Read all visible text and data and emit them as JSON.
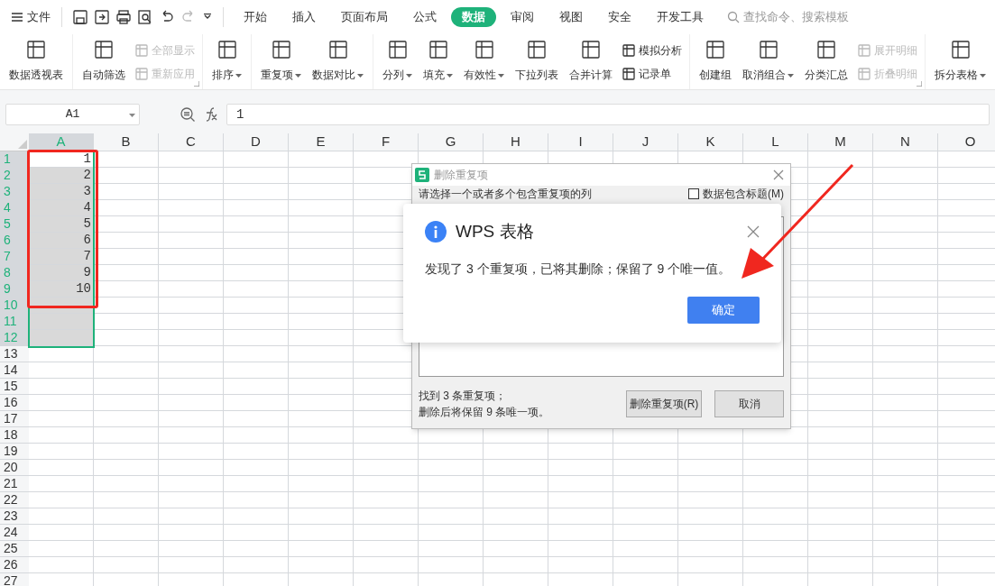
{
  "menu": {
    "label": "文件"
  },
  "tabs": [
    {
      "label": "开始",
      "selected": false
    },
    {
      "label": "插入",
      "selected": false
    },
    {
      "label": "页面布局",
      "selected": false
    },
    {
      "label": "公式",
      "selected": false
    },
    {
      "label": "数据",
      "selected": true
    },
    {
      "label": "审阅",
      "selected": false
    },
    {
      "label": "视图",
      "selected": false
    },
    {
      "label": "安全",
      "selected": false
    },
    {
      "label": "开发工具",
      "selected": false
    }
  ],
  "search": {
    "placeholder": "查找命令、搜索模板"
  },
  "ribbon": {
    "groups": [
      {
        "items": [
          {
            "kind": "big",
            "label": "数据透视表",
            "dropdown": false
          }
        ]
      },
      {
        "launcher": true,
        "items": [
          {
            "kind": "big",
            "label": "自动筛选",
            "dropdown": false
          },
          {
            "kind": "stack",
            "entries": [
              {
                "label": "全部显示",
                "disabled": true
              },
              {
                "label": "重新应用",
                "disabled": true
              }
            ]
          }
        ]
      },
      {
        "items": [
          {
            "kind": "big",
            "label": "排序",
            "dropdown": true
          }
        ]
      },
      {
        "items": [
          {
            "kind": "big",
            "label": "重复项",
            "dropdown": true
          },
          {
            "kind": "big",
            "label": "数据对比",
            "dropdown": true
          }
        ]
      },
      {
        "items": [
          {
            "kind": "big",
            "label": "分列",
            "dropdown": true
          },
          {
            "kind": "big",
            "label": "填充",
            "dropdown": true
          },
          {
            "kind": "big",
            "label": "有效性",
            "dropdown": true
          },
          {
            "kind": "big",
            "label": "下拉列表",
            "dropdown": false
          },
          {
            "kind": "big",
            "label": "合并计算",
            "dropdown": false
          },
          {
            "kind": "stack",
            "entries": [
              {
                "label": "模拟分析",
                "disabled": false
              },
              {
                "label": "记录单",
                "disabled": false
              }
            ]
          }
        ]
      },
      {
        "launcher": true,
        "items": [
          {
            "kind": "big",
            "label": "创建组",
            "dropdown": false
          },
          {
            "kind": "big",
            "label": "取消组合",
            "dropdown": true
          },
          {
            "kind": "big",
            "label": "分类汇总",
            "dropdown": false
          },
          {
            "kind": "stack",
            "entries": [
              {
                "label": "展开明细",
                "disabled": true
              },
              {
                "label": "折叠明细",
                "disabled": true
              }
            ]
          }
        ]
      },
      {
        "items": [
          {
            "kind": "big",
            "label": "拆分表格",
            "dropdown": true
          }
        ]
      }
    ]
  },
  "formula_bar": {
    "name_box": "A1",
    "value": "1"
  },
  "sheet": {
    "columns": [
      {
        "label": "A",
        "selected": true
      },
      {
        "label": "B",
        "selected": false
      },
      {
        "label": "C",
        "selected": false
      },
      {
        "label": "D",
        "selected": false
      },
      {
        "label": "E",
        "selected": false
      },
      {
        "label": "F",
        "selected": false
      },
      {
        "label": "G",
        "selected": false
      },
      {
        "label": "H",
        "selected": false
      },
      {
        "label": "I",
        "selected": false
      },
      {
        "label": "J",
        "selected": false
      },
      {
        "label": "K",
        "selected": false
      },
      {
        "label": "L",
        "selected": false
      },
      {
        "label": "M",
        "selected": false
      },
      {
        "label": "N",
        "selected": false
      },
      {
        "label": "O",
        "selected": false
      }
    ],
    "rows": [
      {
        "header": "1",
        "a": "1",
        "selected": true,
        "active": true
      },
      {
        "header": "2",
        "a": "2",
        "selected": true,
        "active": false
      },
      {
        "header": "3",
        "a": "3",
        "selected": true,
        "active": false
      },
      {
        "header": "4",
        "a": "4",
        "selected": true,
        "active": false
      },
      {
        "header": "5",
        "a": "5",
        "selected": true,
        "active": false
      },
      {
        "header": "6",
        "a": "6",
        "selected": true,
        "active": false
      },
      {
        "header": "7",
        "a": "7",
        "selected": true,
        "active": false
      },
      {
        "header": "8",
        "a": "9",
        "selected": true,
        "active": false
      },
      {
        "header": "9",
        "a": "10",
        "selected": true,
        "active": false
      },
      {
        "header": "10",
        "selected": true,
        "active": false
      },
      {
        "header": "11",
        "selected": true,
        "active": false
      },
      {
        "header": "12",
        "selected": true,
        "active": false
      },
      {
        "header": "13",
        "selected": false,
        "active": false
      },
      {
        "header": "14",
        "selected": false,
        "active": false
      },
      {
        "header": "15",
        "selected": false,
        "active": false
      },
      {
        "header": "16",
        "selected": false,
        "active": false
      },
      {
        "header": "17",
        "selected": false,
        "active": false
      },
      {
        "header": "18",
        "selected": false,
        "active": false
      },
      {
        "header": "19",
        "selected": false,
        "active": false
      },
      {
        "header": "20",
        "selected": false,
        "active": false
      },
      {
        "header": "21",
        "selected": false,
        "active": false
      },
      {
        "header": "22",
        "selected": false,
        "active": false
      },
      {
        "header": "23",
        "selected": false,
        "active": false
      },
      {
        "header": "24",
        "selected": false,
        "active": false
      },
      {
        "header": "25",
        "selected": false,
        "active": false
      },
      {
        "header": "26",
        "selected": false,
        "active": false
      },
      {
        "header": "27",
        "selected": false,
        "active": false
      }
    ]
  },
  "dialog": {
    "title": "删除重复项",
    "prompt": "请选择一个或者多个包含重复项的列",
    "header_checkbox": {
      "label": "数据包含标题(M)",
      "checked": false
    },
    "summary": [
      "找到 3 条重复项；",
      "删除后将保留 9 条唯一项。"
    ],
    "buttons": [
      "删除重复项(R)",
      "取消"
    ]
  },
  "message_box": {
    "title": "WPS 表格",
    "message": "发现了 3 个重复项，已将其删除；保留了 9 个唯一值。",
    "button": "确定"
  },
  "annotations": [
    {
      "kind": "box"
    },
    {
      "kind": "arrow"
    }
  ]
}
